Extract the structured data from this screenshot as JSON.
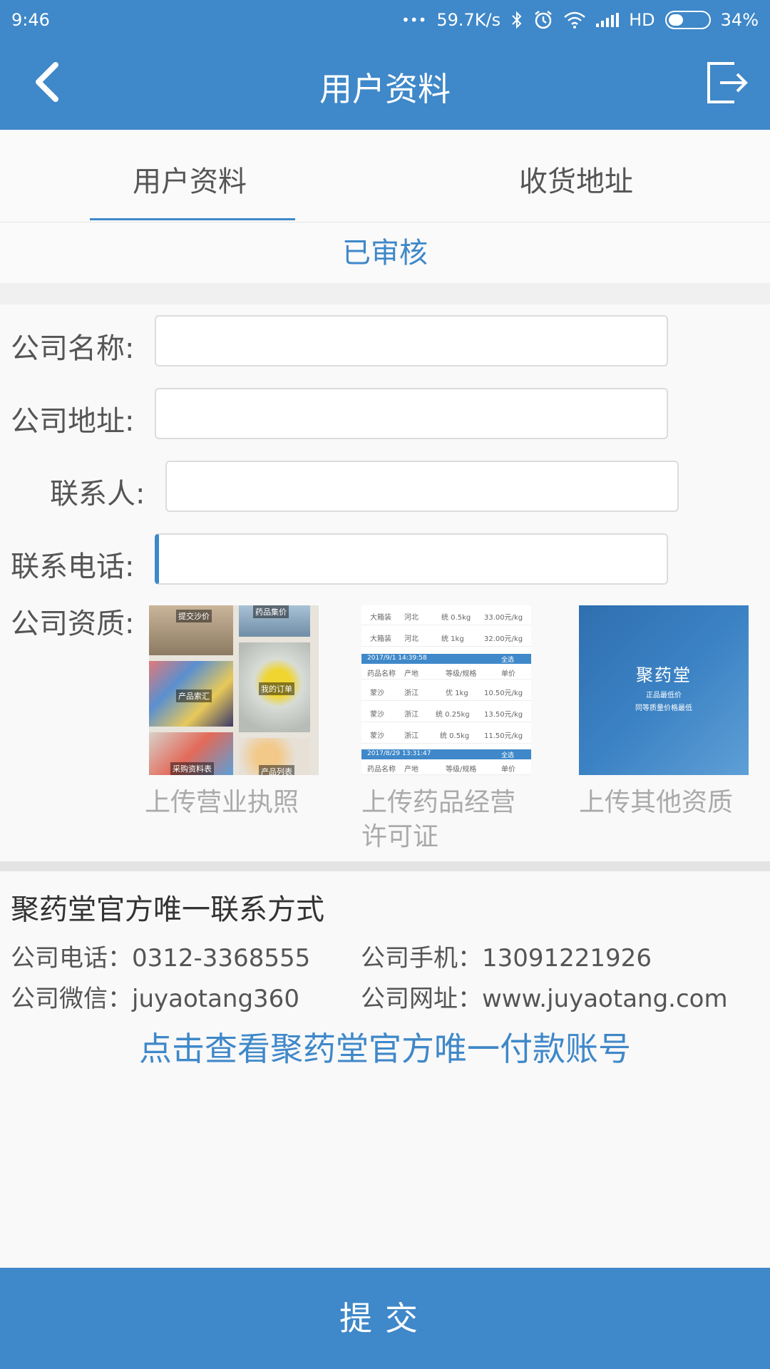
{
  "status_bar": {
    "time": "9:46",
    "dots": "•••",
    "speed": "59.7K/s",
    "network": "HD",
    "battery": "34%"
  },
  "header": {
    "title": "用户资料"
  },
  "tabs": [
    {
      "label": "用户资料",
      "active": true
    },
    {
      "label": "收货地址",
      "active": false
    }
  ],
  "review_status": "已审核",
  "form": {
    "company_name_label": "公司名称:",
    "company_name_value": "",
    "company_address_label": "公司地址:",
    "company_address_value": "",
    "contact_person_label": "联系人:",
    "contact_person_value": "",
    "contact_phone_label": "联系电话:",
    "contact_phone_value": "",
    "qualification_label": "公司资质:"
  },
  "qualifications": {
    "business_license_caption": "上传营业执照",
    "license_tiles": [
      "提交沙价",
      "药品集价",
      "产品索汇",
      "我的订单",
      "采购资料表",
      "产品列表"
    ],
    "drug_permit_caption_line1": "上传药品经营",
    "drug_permit_caption_line2": "许可证",
    "drug_permit_doc": {
      "rows_top": [
        {
          "name": "大箱装",
          "origin": "河北",
          "spec": "统 0.5kg",
          "price": "33.00元/kg"
        },
        {
          "name": "大箱装",
          "origin": "河北",
          "spec": "统 1kg",
          "price": "32.00元/kg"
        }
      ],
      "header1": {
        "date": "2017/9/1 14:39:58",
        "select": "全选"
      },
      "columns": [
        "药品名称",
        "产地",
        "等级/规格",
        "单价"
      ],
      "rows_mid": [
        {
          "name": "蒙沙",
          "origin": "浙江",
          "spec": "优 1kg",
          "price": "10.50元/kg"
        },
        {
          "name": "蒙沙",
          "origin": "浙江",
          "spec": "统 0.25kg",
          "price": "13.50元/kg"
        },
        {
          "name": "蒙沙",
          "origin": "浙江",
          "spec": "统 0.5kg",
          "price": "11.50元/kg"
        }
      ],
      "header2": {
        "date": "2017/8/29 13:31:47",
        "select": "全选"
      }
    },
    "other_caption": "上传其他资质",
    "other_brand": "聚药堂",
    "other_sub1": "正品最低价",
    "other_sub2": "同等质量价格最低"
  },
  "contact": {
    "title": "聚药堂官方唯一联系方式",
    "phone": "公司电话：0312-3368555",
    "mobile": "公司手机：13091221926",
    "wechat": "公司微信：juyaotang360",
    "website": "公司网址：www.juyaotang.com",
    "pay_link": "点击查看聚药堂官方唯一付款账号"
  },
  "submit_label": "提交",
  "colors": {
    "primary": "#3f88c9",
    "background": "#f9f9f9",
    "caption_gray": "#aaaaaa"
  },
  "icons": [
    "back-arrow-icon",
    "logout-icon",
    "bluetooth-icon",
    "alarm-icon",
    "wifi-icon",
    "signal-icon",
    "battery-icon"
  ]
}
